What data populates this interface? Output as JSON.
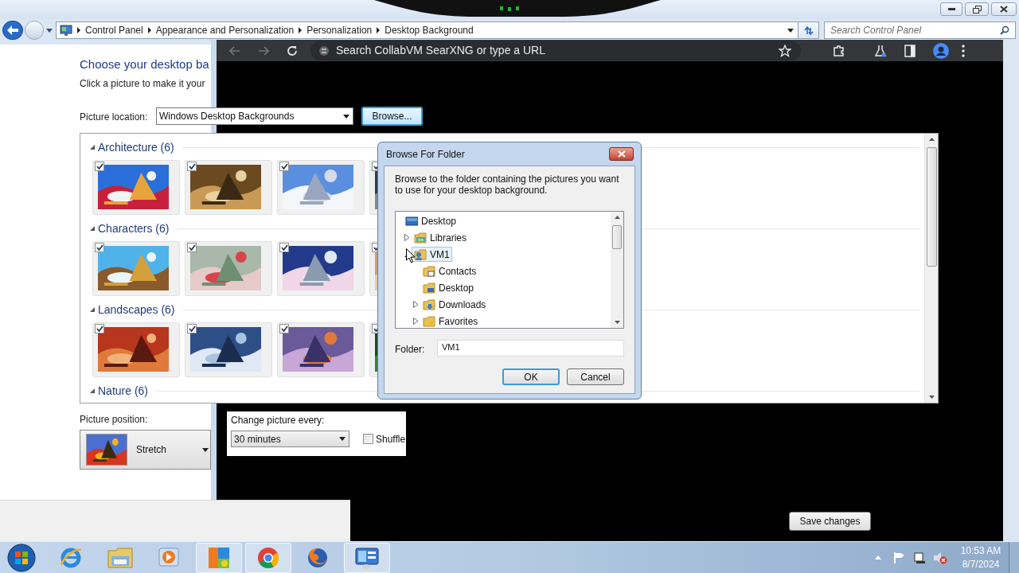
{
  "explorer": {
    "breadcrumb": [
      "Control Panel",
      "Appearance and Personalization",
      "Personalization",
      "Desktop Background"
    ],
    "search_placeholder": "Search Control Panel"
  },
  "browser": {
    "omnibox_placeholder": "Search CollabVM SearXNG or type a URL"
  },
  "page": {
    "heading": "Choose your desktop ba",
    "subheading": "Click a picture to make it your",
    "picture_location": {
      "label": "Picture location:",
      "value": "Windows Desktop Backgrounds"
    },
    "browse_button": "Browse...",
    "groups": [
      {
        "title": "Architecture (6)",
        "expanded": true,
        "thumbnails": [
          {
            "checked": true
          },
          {
            "checked": true
          },
          {
            "checked": true
          },
          {
            "checked": true
          }
        ]
      },
      {
        "title": "Characters (6)",
        "expanded": true,
        "thumbnails": [
          {
            "checked": true
          },
          {
            "checked": true
          },
          {
            "checked": true
          },
          {
            "checked": true
          }
        ]
      },
      {
        "title": "Landscapes (6)",
        "expanded": true,
        "thumbnails": [
          {
            "checked": true
          },
          {
            "checked": true
          },
          {
            "checked": true
          },
          {
            "checked": true
          }
        ]
      },
      {
        "title": "Nature (6)",
        "expanded": true
      }
    ],
    "picture_position": {
      "label": "Picture position:",
      "value": "Stretch"
    },
    "change_every": {
      "label": "Change picture every:",
      "value": "30 minutes"
    },
    "shuffle": {
      "label": "Shuffle",
      "checked": false
    },
    "save_button": "Save changes"
  },
  "dialog": {
    "title": "Browse For Folder",
    "description": "Browse to the folder containing the pictures you want to use for your desktop background.",
    "tree": [
      {
        "label": "Desktop",
        "kind": "desktop",
        "selected": false,
        "children": [
          {
            "label": "Libraries",
            "kind": "library",
            "expanded": false,
            "selected": false
          },
          {
            "label": "VM1",
            "kind": "user",
            "expanded": true,
            "selected": true,
            "children": [
              {
                "label": "Contacts",
                "kind": "contacts",
                "selected": false
              },
              {
                "label": "Desktop",
                "kind": "desktop_folder",
                "selected": false
              },
              {
                "label": "Downloads",
                "kind": "downloads",
                "expanded": false,
                "selected": false
              },
              {
                "label": "Favorites",
                "kind": "favorites",
                "expanded": false,
                "selected": false
              }
            ]
          }
        ]
      }
    ],
    "folder_label": "Folder:",
    "folder_value": "VM1",
    "buttons": [
      {
        "label": "OK",
        "default": true
      },
      {
        "label": "Cancel",
        "default": false
      }
    ]
  },
  "taskbar": {
    "items": [
      {
        "kind": "ie",
        "active": false
      },
      {
        "kind": "explorer",
        "active": false
      },
      {
        "kind": "media",
        "active": false
      },
      {
        "kind": "paint",
        "active": true
      },
      {
        "kind": "chrome",
        "active": true
      },
      {
        "kind": "firefox",
        "active": false
      },
      {
        "kind": "control_panel",
        "active": true
      }
    ],
    "time": "10:53 AM",
    "date": "8/7/2024"
  }
}
